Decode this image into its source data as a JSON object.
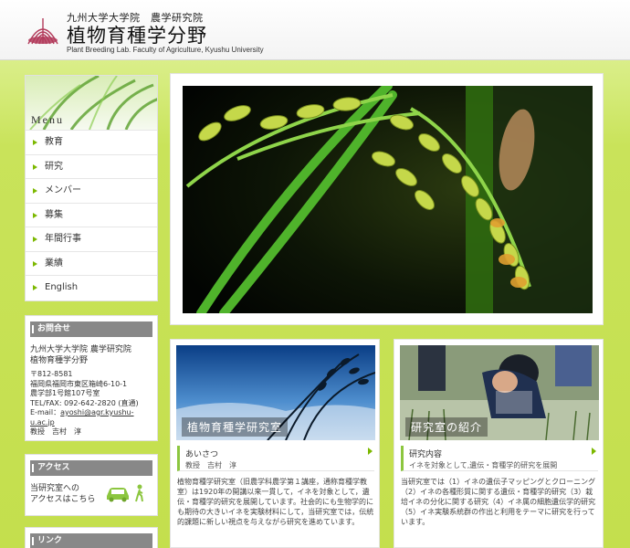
{
  "header": {
    "univ": "九州大学大学院　農学研究院",
    "lab": "植物育種学分野",
    "en": "Plant Breeding Lab. Faculty of Agriculture, Kyushu University"
  },
  "menu": {
    "title": "Menu",
    "items": [
      {
        "label": "教育"
      },
      {
        "label": "研究"
      },
      {
        "label": "メンバー"
      },
      {
        "label": "募集"
      },
      {
        "label": "年間行事"
      },
      {
        "label": "業績"
      },
      {
        "label": "English"
      }
    ]
  },
  "contact": {
    "title": "お問合せ",
    "name_line1": "九州大学大学院 農学研究院",
    "name_line2": "植物育種学分野",
    "postal": "〒812-8581",
    "addr1": "福岡県福岡市東区箱崎6-10-1",
    "addr2": "農学部1号館107号室",
    "tel": "TEL/FAX: 092-642-2820 (直通)",
    "email_label": "E-mail：",
    "email": "ayoshi@agr.kyushu-u.ac.jp",
    "person": "教授　吉村　淳"
  },
  "access": {
    "title": "アクセス",
    "line1": "当研究室への",
    "line2": "アクセスはこちら"
  },
  "links": {
    "title": "リンク"
  },
  "card1": {
    "image_label": "植物育種学研究室",
    "heading": "あいさつ",
    "sub": "教授　吉村　淳",
    "body": "植物育種学研究室（旧農学科農学第１講座，通称育種学教室）は1920年の開講以来一貫して，イネを対象として，遺伝・育種学的研究を展開しています。社会的にも生物学的にも期待の大きいイネを実験材料にして，当研究室では，伝統的課題に新しい視点を与えながら研究を進めています。"
  },
  "card2": {
    "image_label": "研究室の紹介",
    "heading": "研究内容",
    "sub": "イネを対象として,遺伝・育種学的研究を展開",
    "body": "当研究室では（1）イネの遺伝子マッピングとクローニング（2）イネの各種形質に関する遺伝・育種学的研究（3）栽培イネの分化に関する研究（4）イネ属の細胞遺伝学的研究（5）イネ実験系統群の作出と利用をテーマに研究を行っています。"
  },
  "colors": {
    "accent": "#7cb800",
    "background": "#c9e35a",
    "side_title_bg": "#888888"
  }
}
